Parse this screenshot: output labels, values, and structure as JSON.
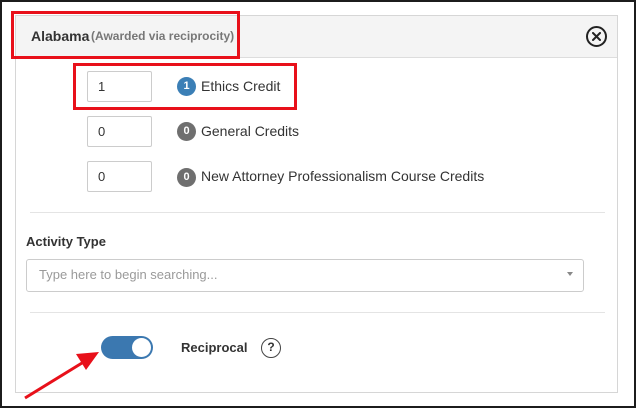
{
  "header": {
    "state": "Alabama",
    "note": "(Awarded via reciprocity)"
  },
  "credits": [
    {
      "value": "1",
      "badge": "1",
      "label": "Ethics Credit",
      "badge_color": "#3b7fb6"
    },
    {
      "value": "0",
      "badge": "0",
      "label": "General Credits",
      "badge_color": "#6f6f6f"
    },
    {
      "value": "0",
      "badge": "0",
      "label": "New Attorney Professionalism Course Credits",
      "badge_color": "#6f6f6f"
    }
  ],
  "activity": {
    "label": "Activity Type",
    "placeholder": "Type here to begin searching..."
  },
  "reciprocal": {
    "label": "Reciprocal",
    "help": "?",
    "toggle_on": true
  },
  "icons": {
    "close": "close-circle-icon",
    "caret": "caret-down-icon",
    "help": "question-circle-icon"
  },
  "colors": {
    "highlight": "#e8101a",
    "toggle_on": "#3b78b0",
    "badge_active": "#3b7fb6",
    "badge_inactive": "#6f6f6f"
  }
}
